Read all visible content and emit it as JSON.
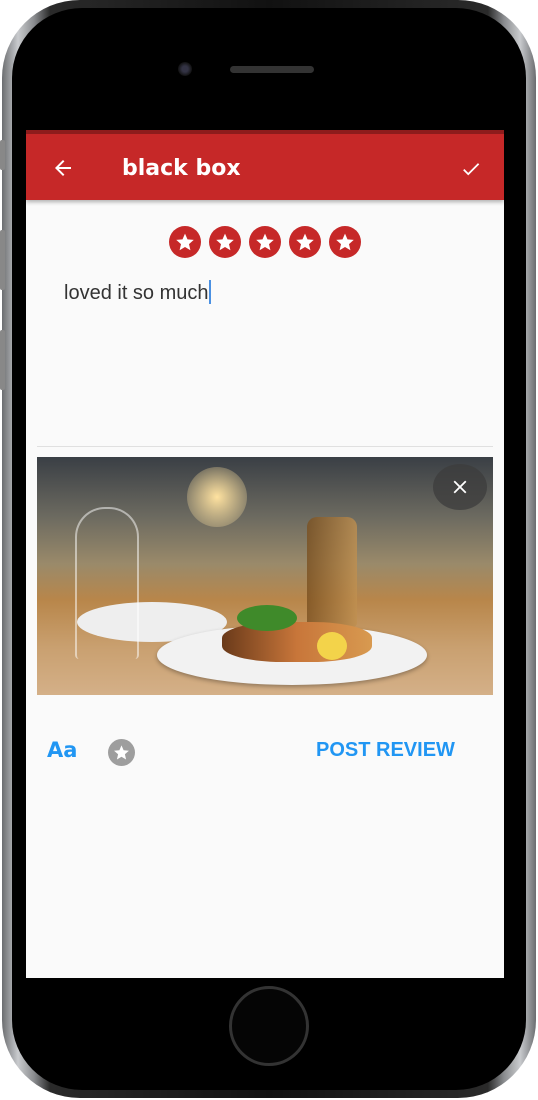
{
  "appbar": {
    "title": "black box",
    "back_icon": "arrow-left-icon",
    "confirm_icon": "check-icon",
    "color": "#c62828"
  },
  "rating": {
    "value": 5,
    "max": 5,
    "icon": "star-circle-icon"
  },
  "review": {
    "text": "loved it so much"
  },
  "photo": {
    "remove_icon": "close-icon"
  },
  "actions": {
    "format_label": "Aa",
    "rate_icon": "star-circle-icon",
    "post_label": "POST REVIEW",
    "accent": "#2196f3"
  }
}
